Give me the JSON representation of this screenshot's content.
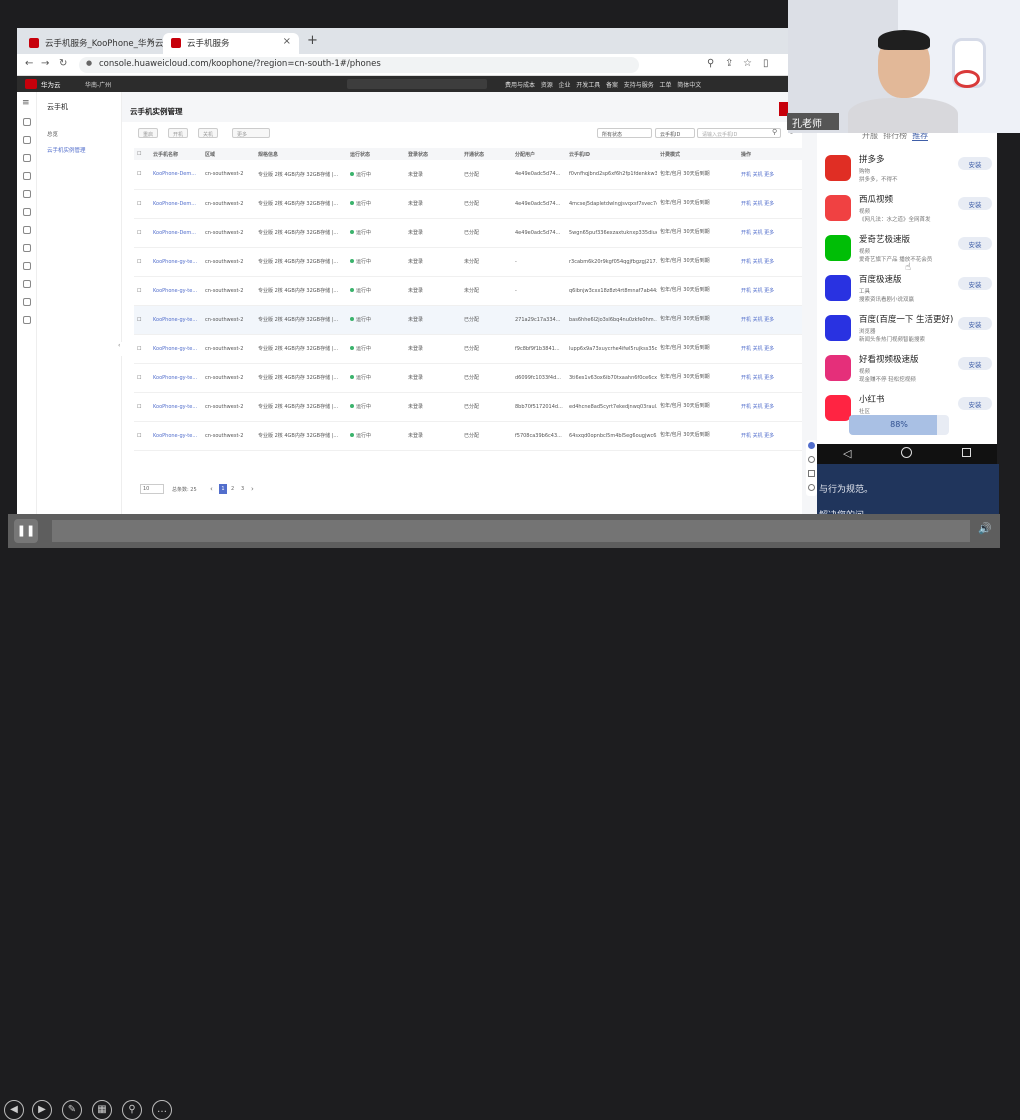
{
  "browser": {
    "tabs": [
      {
        "label": "云手机服务_KooPhone_华为云"
      },
      {
        "label": "云手机服务"
      }
    ],
    "new_tab": "+",
    "url": "console.huaweicloud.com/koophone/?region=cn-south-1#/phones"
  },
  "console": {
    "brand": "华为云",
    "region": "华南-广州",
    "top_links": [
      "费用与成本",
      "资源",
      "企业",
      "开发工具",
      "备案",
      "支持与服务",
      "工单",
      "简体中文"
    ]
  },
  "subnav": {
    "title": "云手机",
    "items": [
      "总览",
      "云手机实例管理"
    ]
  },
  "page": {
    "title": "云手机实例管理",
    "buy_button": "购买",
    "toolbar": {
      "buttons": [
        "重启",
        "开机",
        "关机",
        "更多"
      ],
      "filter_status": "所有状态",
      "filter_field": "云手机ID",
      "search_placeholder": "请输入云手机ID"
    },
    "table": {
      "headers": [
        "云手机名称",
        "区域",
        "规格信息",
        "运行状态",
        "登录状态",
        "开通状态",
        "分配用户",
        "云手机ID",
        "计费模式",
        "操作"
      ],
      "rows": [
        [
          "KooPhone-Dem...",
          "cn-southwest-2",
          "专业版 2核 4GB内存 32GB存储 |...",
          "运行中",
          "未登录",
          "已分配",
          "4e49e0adc5d74...",
          "f0vnfhqjbnd2sp6xf6h2fp1fdenkkw32",
          "包年/包月 30天后到期",
          "开机  关机  更多"
        ],
        [
          "KooPhone-Dem...",
          "cn-southwest-2",
          "专业版 2核 4GB内存 32GB存储 |...",
          "运行中",
          "未登录",
          "已分配",
          "4e49e0adc5d74...",
          "4mcsej5dapletdwlngjsvqxsf7svec7e",
          "包年/包月 30天后到期",
          "开机  关机  更多"
        ],
        [
          "KooPhone-Dem...",
          "cn-southwest-2",
          "专业版 2核 4GB内存 32GB存储 |...",
          "运行中",
          "未登录",
          "已分配",
          "4e49e0adc5d74...",
          "5wgn65puf336exzaxtuknxp335diue...",
          "包年/包月 30天后到期",
          "开机  关机  更多"
        ],
        [
          "KooPhone-gy-te...",
          "cn-southwest-2",
          "专业版 2核 4GB内存 32GB存储 |...",
          "运行中",
          "未登录",
          "未分配",
          "-",
          "r3cabm6k20r9kgf054qgjfbgzgj217...",
          "包年/包月 30天后到期",
          "开机  关机  更多"
        ],
        [
          "KooPhone-gy-te...",
          "cn-southwest-2",
          "专业版 2核 4GB内存 32GB存储 |...",
          "运行中",
          "未登录",
          "未分配",
          "-",
          "q6ibnjw3cxx18z8zt4rt8mnaf7ab44z",
          "包年/包月 30天后到期",
          "开机  关机  更多"
        ],
        [
          "KooPhone-gy-te...",
          "cn-southwest-2",
          "专业版 2核 4GB内存 32GB存储 |...",
          "运行中",
          "未登录",
          "已分配",
          "271a29c17a334...",
          "bas6hhe6l2jo3sl6bq4nu0zkfe0hm...",
          "包年/包月 30天后到期",
          "开机  关机  更多"
        ],
        [
          "KooPhone-gy-te...",
          "cn-southwest-2",
          "专业版 2核 4GB内存 32GB存储 |...",
          "运行中",
          "未登录",
          "已分配",
          "f9c8bf9f1b3841...",
          "lupp6x9a73xuycrhe4ifwl5rujkss35c4",
          "包年/包月 30天后到期",
          "开机  关机  更多"
        ],
        [
          "KooPhone-gy-te...",
          "cn-southwest-2",
          "专业版 2核 4GB内存 32GB存储 |...",
          "运行中",
          "未登录",
          "已分配",
          "d6099fc1033f4d...",
          "3ti6es1v63ox6ib70txaahn6f0ce6cx",
          "包年/包月 30天后到期",
          "开机  关机  更多"
        ],
        [
          "KooPhone-gy-te...",
          "cn-southwest-2",
          "专业版 2核 4GB内存 32GB存储 |...",
          "运行中",
          "未登录",
          "已分配",
          "8bb70f5172014d...",
          "ed4hcne8ad5cyrt7ekedjnwq03raul...",
          "包年/包月 30天后到期",
          "开机  关机  更多"
        ],
        [
          "KooPhone-gy-te...",
          "cn-southwest-2",
          "专业版 2核 4GB内存 32GB存储 |...",
          "运行中",
          "未登录",
          "已分配",
          "f5708ca39b6c43...",
          "64sxqd0opnbcl5m4bl5eg6ougjwc6...",
          "包年/包月 30天后到期",
          "开机  关机  更多"
        ]
      ]
    },
    "pagination": {
      "page_size": "10",
      "total": "总条数: 25",
      "pages": [
        "1",
        "2",
        "3"
      ],
      "prev": "‹",
      "next": "›"
    }
  },
  "webcam": {
    "name": "孔老师"
  },
  "phone": {
    "tabs_partial": [
      "开服",
      "排行榜",
      "推荐"
    ],
    "apps": [
      {
        "name": "拼多多",
        "cat": "购物",
        "desc": "拼多多，不得不",
        "btn": "安装",
        "color": "#e02e24"
      },
      {
        "name": "西瓜视频",
        "cat": "视频",
        "desc": "《网凡法：水之道》全网首发",
        "btn": "安装",
        "color": "#f04142"
      },
      {
        "name": "爱奇艺极速版",
        "cat": "视频",
        "desc": "爱奇艺旗下产品 播放不花会员",
        "btn": "安装",
        "color": "#00be06"
      },
      {
        "name": "百度极速版",
        "cat": "工具",
        "desc": "搜索资讯看剧小说双赢",
        "btn": "安装",
        "color": "#2932e1"
      },
      {
        "name": "百度(百度一下 生活更好)",
        "cat": "浏览器",
        "desc": "新闻头条热门视频智能搜索",
        "btn": "安装",
        "color": "#2932e1"
      },
      {
        "name": "好看视频极速版",
        "cat": "视频",
        "desc": "现金赚不停 轻松挖视频",
        "btn": "安装",
        "color": "#e52f7a"
      },
      {
        "name": "小红书",
        "cat": "社区",
        "desc": "",
        "btn": "安装",
        "color": "#ff2442"
      }
    ],
    "progress_label": "88%",
    "progress": 0.88
  },
  "background_text": {
    "line1": "与行为规范。",
    "line2": "解决您的问"
  },
  "player": {
    "pause_glyph": "❚❚",
    "volume_glyph": "🔊"
  }
}
